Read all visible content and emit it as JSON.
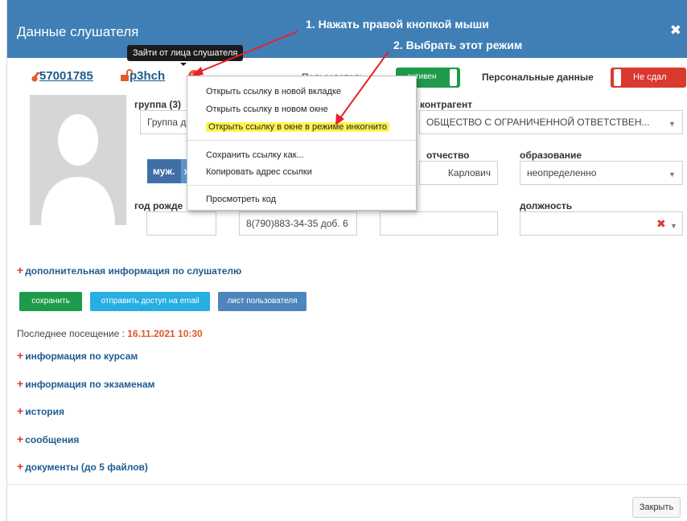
{
  "header": {
    "title": "Данные слушателя",
    "close_icon": "close-icon"
  },
  "annotations": {
    "step1": "1. Нажать правой кнопкой мыши",
    "step2": "2. Выбрать этот режим"
  },
  "tooltip": "Зайти от лица слушателя",
  "user": {
    "id": "57001785",
    "login": "p3hch"
  },
  "status": {
    "user_label": "Пользователь",
    "user_toggle": "активен",
    "personal_label": "Персональные данные",
    "personal_toggle": "Не сдал",
    "colors": {
      "active": "#1f9a4b",
      "fail": "#d9392f",
      "header": "#3f7fb6",
      "link": "#1d5b92"
    }
  },
  "form": {
    "group_label": "группа (3)",
    "group_value": "Группа д",
    "contractor_label": "контрагент",
    "contractor_value": "ОБЩЕСТВО С ОГРАНИЧЕННОЙ ОТВЕТСТВЕН...",
    "gender_male": "муж.",
    "gender_female": "ж",
    "patronymic_label": "отчество",
    "patronymic_value": "Карлович",
    "education_label": "образование",
    "education_value": "неопределенно",
    "birth_label": "год рожде",
    "phone_value": "8(790)883-34-35 доб. 6",
    "position_label": "должность"
  },
  "context_menu": [
    {
      "label": "Открыть ссылку в новой вкладке"
    },
    {
      "label": "Открыть ссылку в новом окне"
    },
    {
      "label": "Открыть ссылку в окне в режиме инкогнито"
    },
    {
      "label": "Сохранить ссылку как..."
    },
    {
      "label": "Копировать адрес ссылки"
    },
    {
      "label": "Просмотреть код"
    }
  ],
  "extra_info": "дополнительная информация по слушателю",
  "buttons": {
    "save": "сохранить",
    "send_email": "отправить доступ на email",
    "user_sheet": "лист пользователя",
    "close": "Закрыть"
  },
  "last_visit": {
    "label": "Последнее посещение : ",
    "value": "16.11.2021 10:30"
  },
  "sections": [
    "информация по курсам",
    "информация по экзаменам",
    "история",
    "сообщения",
    "документы (до 5 файлов)"
  ]
}
